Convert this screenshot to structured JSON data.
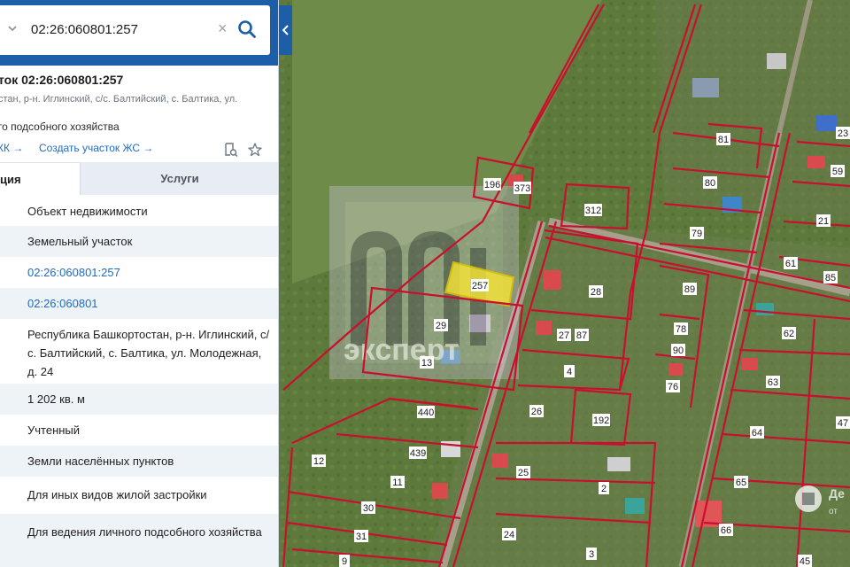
{
  "search": {
    "value": "02:26:060801:257",
    "chevron": "chevron-down-icon",
    "clear": "×"
  },
  "object": {
    "title": "ток 02:26:060801:257",
    "address_short": "стан, р-н. Иглинский, с/с. Балтийский, с. Балтика, ул.",
    "use_short": "го подсобного хозяйства"
  },
  "links": {
    "egrn": "КК →",
    "create": "Создать участок ЖС →"
  },
  "tabs": {
    "info": "ция",
    "services": "Услуги"
  },
  "details": [
    {
      "value": "Объект недвижимости",
      "link": false
    },
    {
      "value": "Земельный участок",
      "link": false
    },
    {
      "value": "02:26:060801:257",
      "link": true
    },
    {
      "value": "02:26:060801",
      "link": true
    },
    {
      "value": "Республика Башкортостан, р-н. Иглинский, с/с. Балтийский, с. Балтика, ул. Молодежная, д. 24",
      "link": false
    },
    {
      "value": "1 202 кв. м",
      "link": false
    },
    {
      "value": "Учтенный",
      "link": false
    },
    {
      "value": "Земли населённых пунктов",
      "link": false
    },
    {
      "value": "Для иных видов жилой застройки",
      "link": false
    },
    {
      "value": "Для ведения личного подсобного хозяйства",
      "link": false
    }
  ],
  "map": {
    "watermark_text": "эксперт",
    "badge_text": "Де",
    "badge_sub": "от",
    "highlight_color": "#f2e13a",
    "boundary_color": "#c8102e",
    "plots": [
      "196",
      "373",
      "312",
      "257",
      "28",
      "29",
      "13",
      "27",
      "87",
      "4",
      "26",
      "192",
      "440",
      "439",
      "12",
      "11",
      "25",
      "2",
      "30",
      "31",
      "24",
      "3",
      "9",
      "81",
      "80",
      "79",
      "89",
      "78",
      "90",
      "76",
      "62",
      "63",
      "64",
      "65",
      "66",
      "23",
      "59",
      "21",
      "61",
      "85",
      "47",
      "45"
    ]
  },
  "colors": {
    "accent": "#1c5fa8",
    "link": "#1f6bc1",
    "row_alt": "#eef3f8"
  }
}
